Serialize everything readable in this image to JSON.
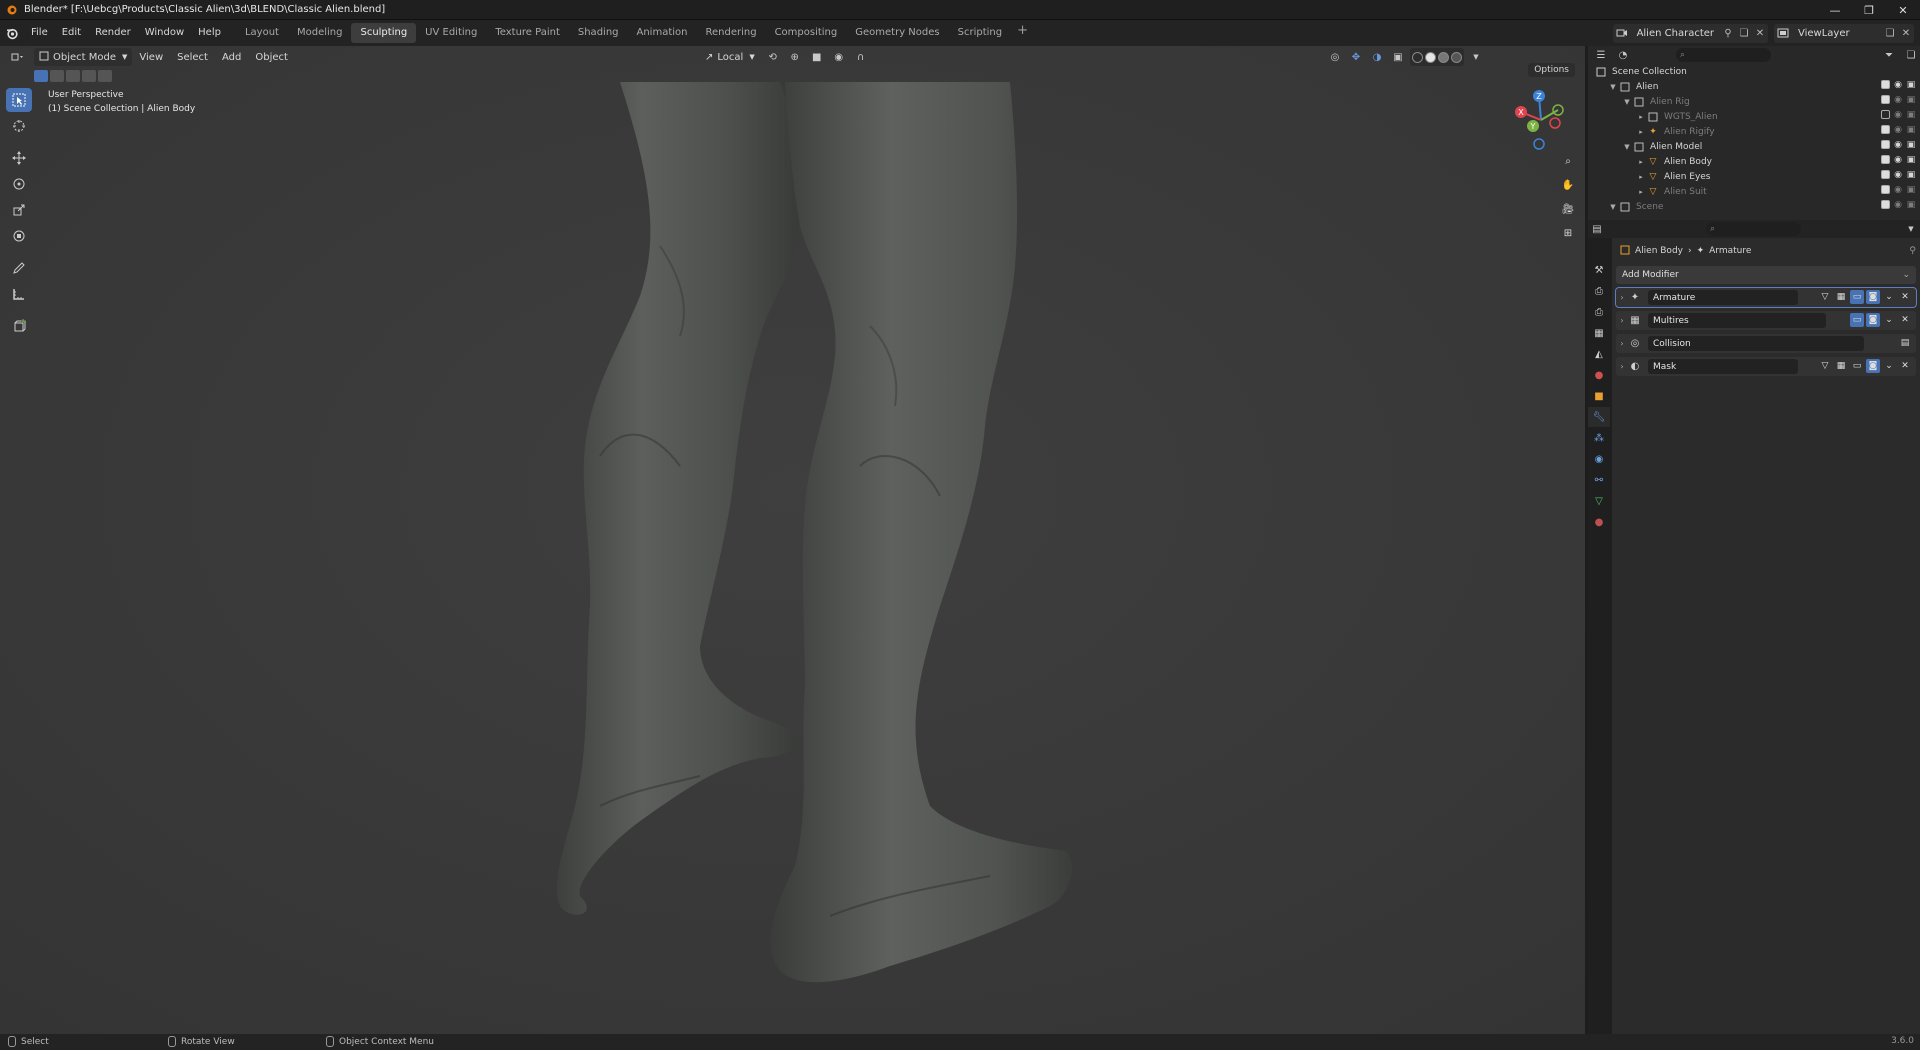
{
  "window": {
    "title": "Blender* [F:\\Uebcg\\Products\\Classic Alien\\3d\\BLEND\\Classic Alien.blend]",
    "min_glyph": "—",
    "max_glyph": "❐",
    "close_glyph": "✕"
  },
  "menu": {
    "items": [
      "File",
      "Edit",
      "Render",
      "Window",
      "Help"
    ]
  },
  "workspaces": {
    "tabs": [
      "Layout",
      "Modeling",
      "Sculpting",
      "UV Editing",
      "Texture Paint",
      "Shading",
      "Animation",
      "Rendering",
      "Compositing",
      "Geometry Nodes",
      "Scripting"
    ],
    "active": "Sculpting",
    "add_glyph": "+"
  },
  "scene": {
    "scene_name": "Alien Character",
    "view_layer": "ViewLayer"
  },
  "viewport": {
    "mode": "Object Mode",
    "menus": [
      "View",
      "Select",
      "Add",
      "Object"
    ],
    "transform_orientation": "Local",
    "options_label": "Options",
    "info_line1": "User Perspective",
    "info_line2": "(1) Scene Collection | Alien Body",
    "gizmo_labels": {
      "z": "Z",
      "y": "Y",
      "x": "X"
    }
  },
  "outliner": {
    "root": "Scene Collection",
    "rows": [
      {
        "label": "Alien",
        "indent": 1,
        "dim": false
      },
      {
        "label": "Alien Rig",
        "indent": 2,
        "dim": true
      },
      {
        "label": "WGTS_Alien",
        "indent": 3,
        "dim": true
      },
      {
        "label": "Alien Rigify",
        "indent": 3,
        "dim": true
      },
      {
        "label": "Alien Model",
        "indent": 2,
        "dim": false
      },
      {
        "label": "Alien Body",
        "indent": 3,
        "dim": false
      },
      {
        "label": "Alien Eyes",
        "indent": 3,
        "dim": false
      },
      {
        "label": "Alien Suit",
        "indent": 3,
        "dim": true
      },
      {
        "label": "Scene",
        "indent": 1,
        "dim": true
      }
    ]
  },
  "properties": {
    "object_name": "Alien Body",
    "data_name": "Armature",
    "add_modifier_label": "Add Modifier",
    "modifiers": [
      {
        "name": "Armature",
        "selected": true
      },
      {
        "name": "Multires",
        "selected": false
      },
      {
        "name": "Collision",
        "selected": false
      },
      {
        "name": "Mask",
        "selected": false
      }
    ]
  },
  "statusbar": {
    "select": "Select",
    "rotate": "Rotate View",
    "context": "Object Context Menu",
    "version": "3.6.0"
  },
  "colors": {
    "accent": "#4772b3",
    "viewport_bg": "#3b3b3b",
    "axis_x": "#e0454f",
    "axis_y": "#7cb342",
    "axis_z": "#3b82d8"
  }
}
